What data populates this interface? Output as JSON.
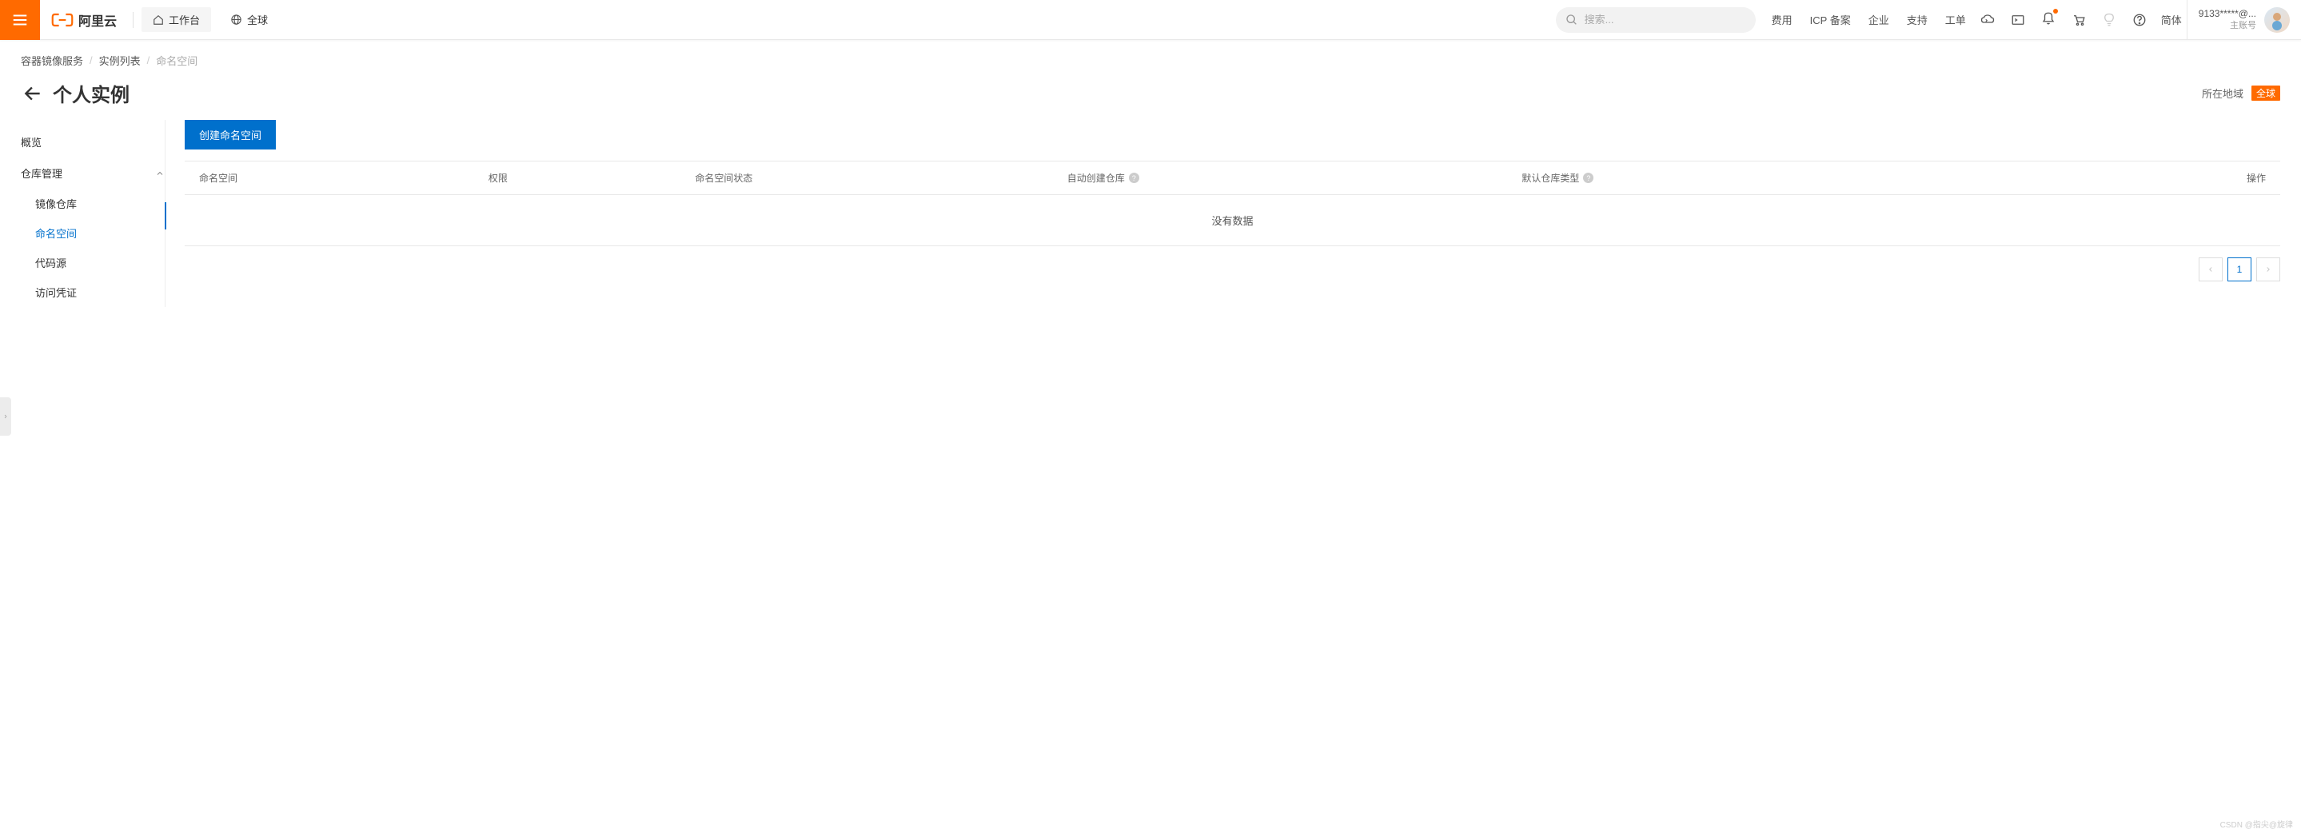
{
  "header": {
    "logo_text": "阿里云",
    "console_label": "工作台",
    "region_global": "全球",
    "search_placeholder": "搜索...",
    "nav": {
      "cost": "费用",
      "icp": "ICP 备案",
      "enterprise": "企业",
      "support": "支持",
      "ticket": "工单"
    },
    "lang": "简体",
    "account": {
      "id": "9133*****@...",
      "type": "主账号"
    }
  },
  "breadcrumb": {
    "root": "容器镜像服务",
    "list": "实例列表",
    "current": "命名空间"
  },
  "title": {
    "page_title": "个人实例",
    "region_label": "所在地域",
    "region_value": "全球"
  },
  "sidebar": {
    "overview": "概览",
    "repo_mgmt": "仓库管理",
    "image_repo": "镜像仓库",
    "namespace": "命名空间",
    "code_source": "代码源",
    "credential": "访问凭证"
  },
  "content": {
    "create_btn": "创建命名空间",
    "table": {
      "namespace": "命名空间",
      "permission": "权限",
      "status": "命名空间状态",
      "auto_create": "自动创建仓库",
      "default_type": "默认仓库类型",
      "operation": "操作"
    },
    "empty": "没有数据",
    "page_number": "1"
  },
  "watermark": "CSDN @指尖@旋律"
}
